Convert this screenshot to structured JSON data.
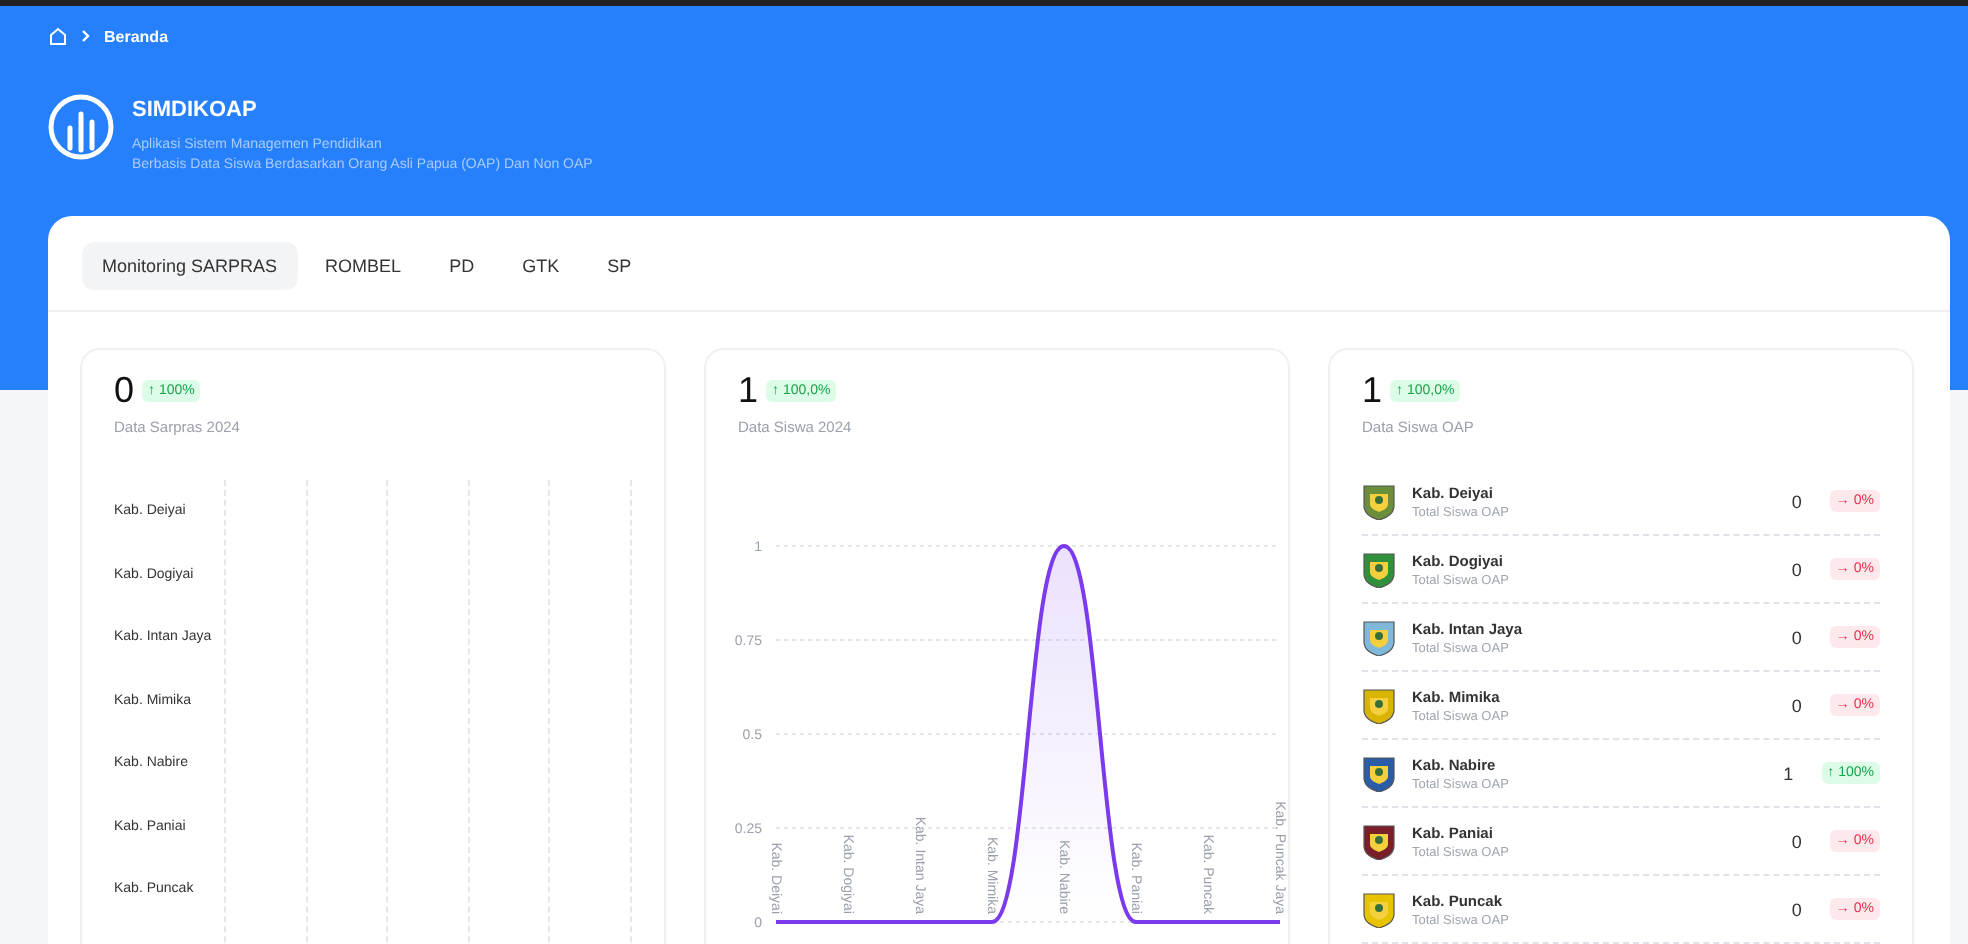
{
  "breadcrumb": {
    "label": "Beranda"
  },
  "app": {
    "title": "SIMDIKOAP",
    "subtitle_lines": [
      "Aplikasi Sistem Managemen Pendidikan",
      "Berbasis Data Siswa Berdasarkan Orang Asli Papua (OAP) Dan Non OAP"
    ]
  },
  "tabs": [
    {
      "label": "Monitoring SARPRAS",
      "selected": true
    },
    {
      "label": "ROMBEL",
      "selected": false
    },
    {
      "label": "PD",
      "selected": false
    },
    {
      "label": "GTK",
      "selected": false
    },
    {
      "label": "SP",
      "selected": false
    }
  ],
  "cards": [
    {
      "kind": "bar",
      "value": "0",
      "arrow": "↑",
      "change": "100%",
      "positive": true,
      "caption": "Data Sarpras 2024",
      "row_labels": [
        "Kab. Deiyai",
        "Kab. Dogiyai",
        "Kab. Intan Jaya",
        "Kab. Mimika",
        "Kab. Nabire",
        "Kab. Paniai",
        "Kab. Puncak"
      ]
    },
    {
      "kind": "line",
      "value": "1",
      "arrow": "↑",
      "change": "100,0%",
      "positive": true,
      "caption": "Data Siswa 2024",
      "chart_data": {
        "type": "area",
        "grid": true,
        "categories": [
          "Kab. Deiyai",
          "Kab. Dogiyai",
          "Kab. Intan Jaya",
          "Kab. Mimika",
          "Kab. Nabire",
          "Kab. Paniai",
          "Kab. Puncak",
          "Kab. Puncak Jaya"
        ],
        "series": [
          {
            "color": "#7c3aed",
            "values": [
              0,
              0,
              0,
              0,
              1,
              0,
              0,
              0
            ]
          }
        ],
        "ylim": [
          0,
          1
        ],
        "yticks": [
          0,
          0.25,
          0.5,
          0.75,
          1
        ]
      }
    },
    {
      "kind": "list",
      "value": "1",
      "arrow": "↑",
      "change": "100,0%",
      "positive": true,
      "caption": "Data Siswa OAP",
      "items": [
        {
          "name": "Kab. Deiyai",
          "sub": "Total Siswa OAP",
          "value": "0",
          "arrow": "→",
          "change": "0%",
          "positive": false,
          "color": "#6b8e3a"
        },
        {
          "name": "Kab. Dogiyai",
          "sub": "Total Siswa OAP",
          "value": "0",
          "arrow": "→",
          "change": "0%",
          "positive": false,
          "color": "#2f8f3a"
        },
        {
          "name": "Kab. Intan Jaya",
          "sub": "Total Siswa OAP",
          "value": "0",
          "arrow": "→",
          "change": "0%",
          "positive": false,
          "color": "#7fb8d8"
        },
        {
          "name": "Kab. Mimika",
          "sub": "Total Siswa OAP",
          "value": "0",
          "arrow": "→",
          "change": "0%",
          "positive": false,
          "color": "#d9b400"
        },
        {
          "name": "Kab. Nabire",
          "sub": "Total Siswa OAP",
          "value": "1",
          "arrow": "↑",
          "change": "100%",
          "positive": true,
          "color": "#2a5ca8"
        },
        {
          "name": "Kab. Paniai",
          "sub": "Total Siswa OAP",
          "value": "0",
          "arrow": "→",
          "change": "0%",
          "positive": false,
          "color": "#7a1f2a"
        },
        {
          "name": "Kab. Puncak",
          "sub": "Total Siswa OAP",
          "value": "0",
          "arrow": "→",
          "change": "0%",
          "positive": false,
          "color": "#e8c300"
        }
      ]
    }
  ]
}
